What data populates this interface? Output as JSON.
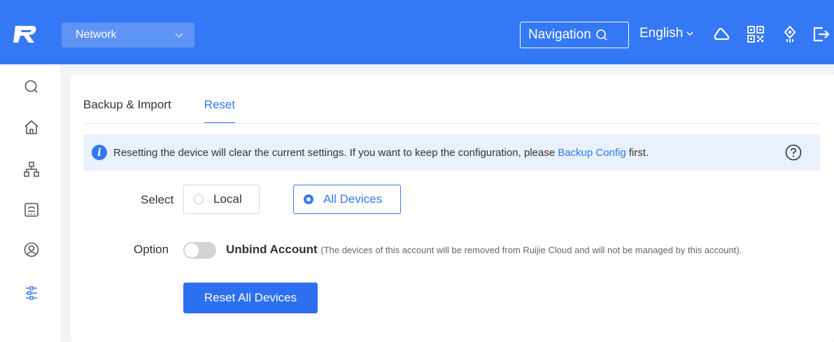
{
  "header": {
    "network_label": "Network",
    "navigation_label": "Navigation",
    "language_label": "English",
    "brand_color": "#3478f6"
  },
  "sidebar": {
    "items": [
      {
        "icon": "search-icon"
      },
      {
        "icon": "home-icon"
      },
      {
        "icon": "topology-icon"
      },
      {
        "icon": "device-icon"
      },
      {
        "icon": "user-icon"
      },
      {
        "icon": "settings-sliders-icon"
      }
    ]
  },
  "tabs": [
    {
      "label": "Backup & Import",
      "active": false
    },
    {
      "label": "Reset",
      "active": true
    }
  ],
  "info": {
    "text_before": "Resetting the device will clear the current settings. If you want to keep the configuration, please",
    "link_text": "Backup Config",
    "text_after": "first."
  },
  "form": {
    "select_label": "Select",
    "options": [
      {
        "label": "Local",
        "selected": false
      },
      {
        "label": "All Devices",
        "selected": true
      }
    ],
    "option_label": "Option",
    "unbind_title": "Unbind Account",
    "unbind_note": "(The devices of this account will be removed from Ruijie Cloud and will not be managed by this account).",
    "unbind_enabled": false,
    "reset_button": "Reset All Devices"
  }
}
